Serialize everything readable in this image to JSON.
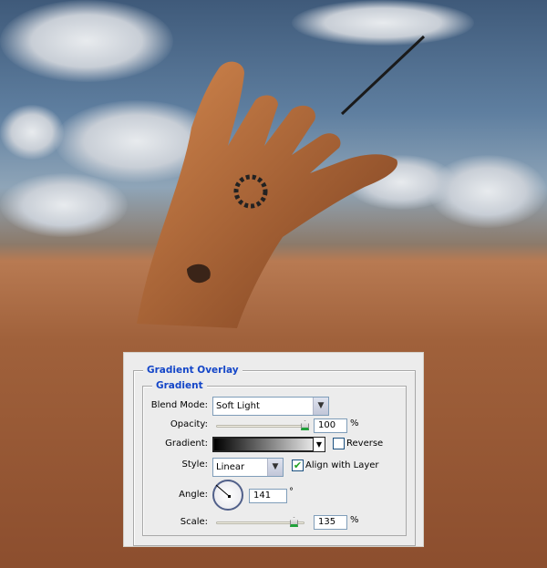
{
  "dialog": {
    "section_title": "Gradient Overlay",
    "group_title": "Gradient",
    "blend_mode": {
      "label": "Blend Mode:",
      "value": "Soft Light"
    },
    "opacity": {
      "label": "Opacity:",
      "value": "100",
      "unit": "%",
      "slider_percent": 100
    },
    "gradient": {
      "label": "Gradient:",
      "from_color": "#000000",
      "to_color": "#ffffff"
    },
    "reverse": {
      "label": "Reverse",
      "checked": false
    },
    "style": {
      "label": "Style:",
      "value": "Linear"
    },
    "align_with_layer": {
      "label": "Align with Layer",
      "checked": true
    },
    "angle": {
      "label": "Angle:",
      "value": "141",
      "unit": "°"
    },
    "scale": {
      "label": "Scale:",
      "value": "135",
      "unit": "%"
    }
  },
  "colors": {
    "accent": "#1446c8",
    "check": "#21a121"
  }
}
